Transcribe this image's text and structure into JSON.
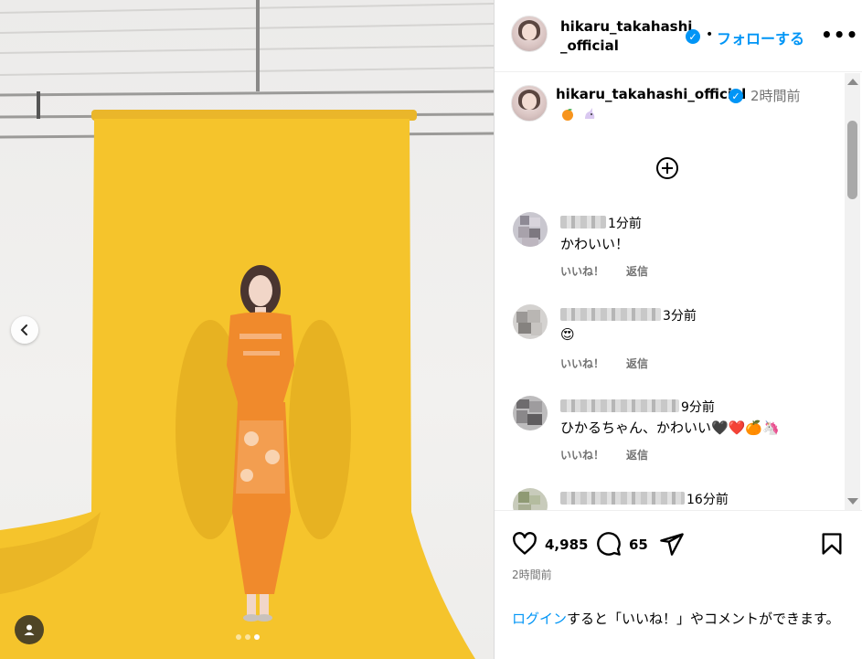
{
  "header": {
    "username": "hikaru_takahashi_official",
    "separator": "•",
    "follow_label": "フォローする",
    "more_label": "•••"
  },
  "caption": {
    "username": "hikaru_takahashi_official",
    "time": "2時間前",
    "emojis": [
      "tangerine-emoji",
      "unicorn-emoji"
    ]
  },
  "comments": [
    {
      "time": "1分前",
      "text": "かわいい！",
      "like_label": "いいね！",
      "reply_label": "返信"
    },
    {
      "time": "3分前",
      "text": "😍",
      "like_label": "いいね！",
      "reply_label": "返信"
    },
    {
      "time": "9分前",
      "text": "ひかるちゃん、かわいい🖤❤️🍊🦄",
      "like_label": "いいね！",
      "reply_label": "返信"
    },
    {
      "time": "16分前",
      "text": "",
      "like_label": "",
      "reply_label": ""
    }
  ],
  "actions": {
    "likes": "4,985",
    "comments": "65",
    "posted": "2時間前"
  },
  "footer": {
    "login_link": "ログイン",
    "login_rest": "すると「いいね！」やコメントができます。"
  },
  "carousel": {
    "slide_count": 3,
    "active_slide": 3
  },
  "colors": {
    "accent": "#0095f6",
    "backdrop_yellow": "#f5c42c",
    "dress_orange": "#f08a2c"
  }
}
